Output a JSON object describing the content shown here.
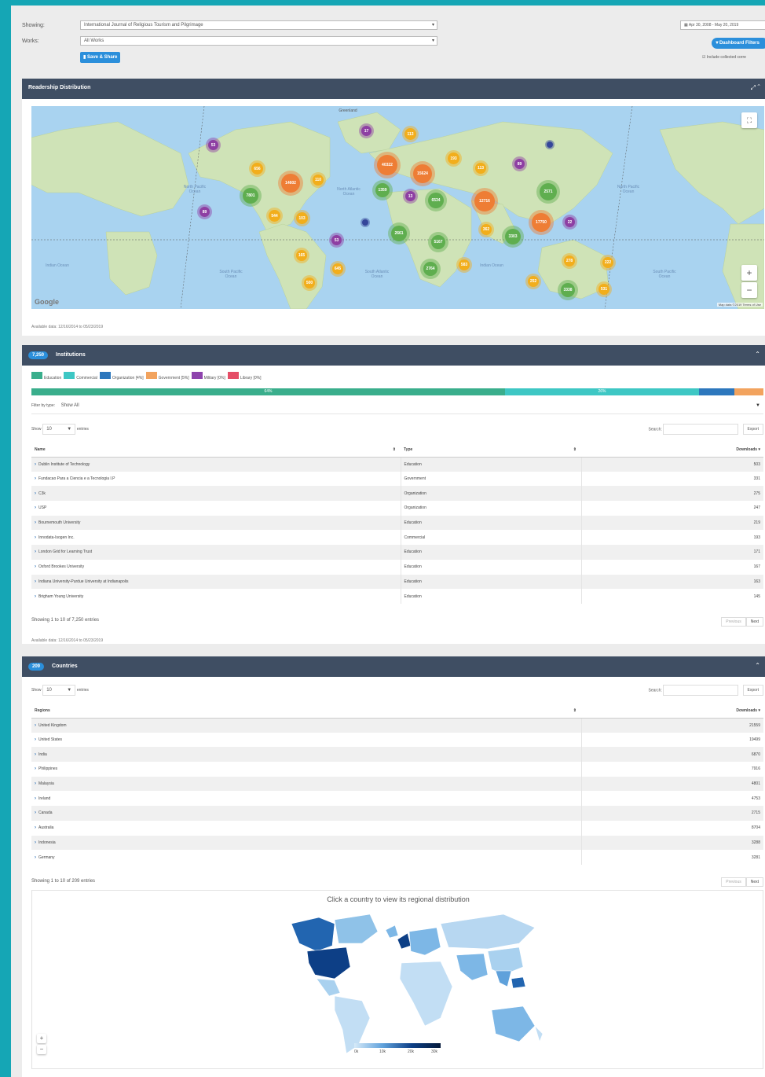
{
  "filters": {
    "showing_label": "Showing:",
    "showing_value": "International Journal of Religious Tourism and Pilgrimage",
    "works_label": "Works:",
    "works_value": "All Works",
    "save_share": "Save & Share",
    "date_range": "Apr 30, 2008 - May 20, 2019",
    "dashboard_filters": "Dashboard Filters",
    "include_label": "Include collected corre"
  },
  "readership": {
    "title": "Readership Distribution",
    "available_data": "Available data: 12/16/2014 to 05/23/2019",
    "google": "Google",
    "map_footer": "Map data ©2019   Terms of Use",
    "greenland": "Greenland",
    "ocean_labels": [
      "North Pacific Ocean",
      "North Atlantic Ocean",
      "North Pacific Ocean",
      "South Pacific Ocean",
      "South Atlantic Ocean",
      "Indian Ocean",
      "Indian Ocean",
      "South Pacific Ocean"
    ],
    "clusters": [
      "17",
      "53",
      "113",
      "40322",
      "15624",
      "193",
      "113",
      "89",
      "656",
      "14602",
      "110",
      "7801",
      "1359",
      "6534",
      "13",
      "12716",
      "2571",
      "89",
      "544",
      "103",
      "2661",
      "5167",
      "3303",
      "17750",
      "22",
      "362",
      "53",
      "165",
      "645",
      "2764",
      "583",
      "278",
      "222",
      "252",
      "500",
      "3338",
      "531"
    ]
  },
  "institutions": {
    "count": "7,250",
    "title": "Institutions",
    "legend": [
      {
        "label": "Education",
        "color": "#3aae8c"
      },
      {
        "label": "Commercial",
        "color": "#3ec7c4"
      },
      {
        "label": "Organization [4%]",
        "color": "#2d77bd"
      },
      {
        "label": "Government [5%]",
        "color": "#f2a35e"
      },
      {
        "label": "Military [0%]",
        "color": "#8e44ad"
      },
      {
        "label": "Library [0%]",
        "color": "#e54e67"
      }
    ],
    "bar_pct_1": "64%",
    "bar_pct_2": "26%",
    "filter_label": "Filter by type:",
    "filter_value": "Show All",
    "show": "Show",
    "entries_value": "10",
    "entries": "entries",
    "search": "Search:",
    "export": "Export",
    "col_name": "Name",
    "col_type": "Type",
    "col_downloads": "Downloads",
    "rows": [
      {
        "name": "Dublin Institute of Technology",
        "type": "Education",
        "downloads": "503"
      },
      {
        "name": "Fundacao Para a Ciencia e a Tecnologia I.P",
        "type": "Government",
        "downloads": "331"
      },
      {
        "name": "C3k",
        "type": "Organization",
        "downloads": "275"
      },
      {
        "name": "USP",
        "type": "Organization",
        "downloads": "247"
      },
      {
        "name": "Bournemouth University",
        "type": "Education",
        "downloads": "219"
      },
      {
        "name": "Innodata-Isogen Inc.",
        "type": "Commercial",
        "downloads": "193"
      },
      {
        "name": "London Grid for Learning Trust",
        "type": "Education",
        "downloads": "171"
      },
      {
        "name": "Oxford Brookes University",
        "type": "Education",
        "downloads": "167"
      },
      {
        "name": "Indiana University-Purdue University at Indianapolis",
        "type": "Education",
        "downloads": "163"
      },
      {
        "name": "Brigham Young University",
        "type": "Education",
        "downloads": "145"
      }
    ],
    "showing_info": "Showing 1 to 10 of 7,250 entries",
    "previous": "Previous",
    "next": "Next",
    "available_data": "Available data: 12/16/2014 to 05/23/2019"
  },
  "countries": {
    "count": "209",
    "title": "Countries",
    "show": "Show",
    "entries_value": "10",
    "entries": "entries",
    "search": "Search:",
    "export": "Export",
    "col_region": "Regions",
    "col_downloads": "Downloads",
    "rows": [
      {
        "name": "United Kingdom",
        "downloads": "21559"
      },
      {
        "name": "United States",
        "downloads": "19499"
      },
      {
        "name": "India",
        "downloads": "6870"
      },
      {
        "name": "Philippines",
        "downloads": "7916"
      },
      {
        "name": "Malaysia",
        "downloads": "4801"
      },
      {
        "name": "Ireland",
        "downloads": "4753"
      },
      {
        "name": "Canada",
        "downloads": "2715"
      },
      {
        "name": "Australia",
        "downloads": "8704"
      },
      {
        "name": "Indonesia",
        "downloads": "3288"
      },
      {
        "name": "Germany",
        "downloads": "3281"
      }
    ],
    "showing_info": "Showing 1 to 10 of 209 entries",
    "previous": "Previous",
    "next": "Next",
    "choropleth_title": "Click a country to view its regional distribution",
    "scale_ticks": [
      "0k",
      "10k",
      "20k",
      "30k"
    ]
  }
}
